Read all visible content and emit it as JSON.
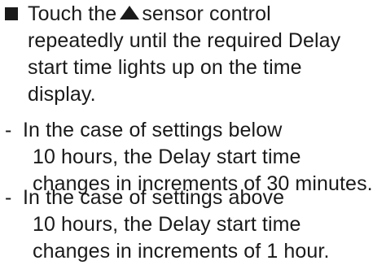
{
  "instruction": {
    "marker": "■",
    "before_icon": "Touch the",
    "icon": "up-triangle-icon",
    "after_icon": "sensor control",
    "lines": [
      "repeatedly until the required Delay",
      "start time lights up on the time",
      "display."
    ]
  },
  "notes": [
    {
      "marker": "-",
      "lines": [
        "In the case of settings below",
        "10 hours, the Delay start time",
        "changes in increments of 30 minutes."
      ]
    },
    {
      "marker": "-",
      "lines": [
        "In the case of settings above",
        "10 hours, the Delay start time",
        "changes in increments of 1 hour."
      ]
    }
  ]
}
